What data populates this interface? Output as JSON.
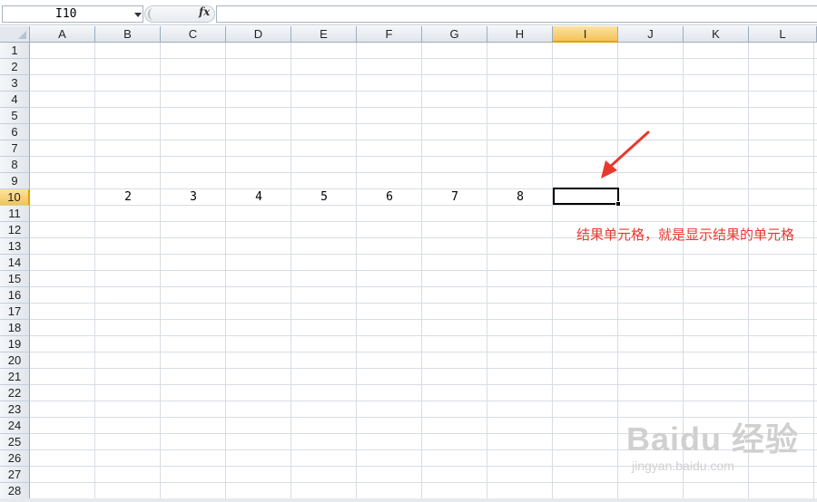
{
  "formula_bar": {
    "name_box": "I10",
    "fx_label": "fx",
    "formula_value": ""
  },
  "columns": [
    "A",
    "B",
    "C",
    "D",
    "E",
    "F",
    "G",
    "H",
    "I",
    "J",
    "K",
    "L"
  ],
  "active_column": "I",
  "rows": [
    "1",
    "2",
    "3",
    "4",
    "5",
    "6",
    "7",
    "8",
    "9",
    "10",
    "11",
    "12",
    "13",
    "14",
    "15",
    "16",
    "17",
    "18",
    "19",
    "20",
    "21",
    "22",
    "23",
    "24",
    "25",
    "26",
    "27",
    "28"
  ],
  "active_row": "10",
  "row10_values": {
    "B": "2",
    "C": "3",
    "D": "4",
    "E": "5",
    "F": "6",
    "G": "7",
    "H": "8"
  },
  "annotation_text": "结果单元格，就是显示结果的单元格",
  "annotation_color": "#e8392f",
  "watermark": {
    "main": "Baidu 经验",
    "sub": "jingyan.baidu.com"
  }
}
